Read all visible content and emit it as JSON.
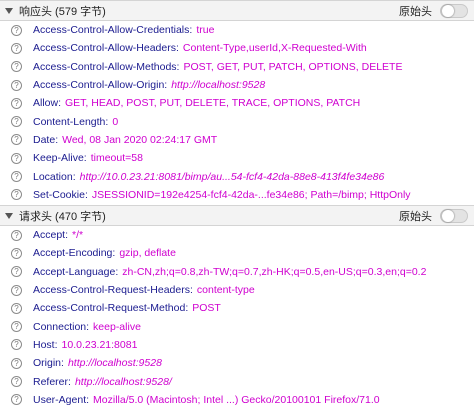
{
  "response_section": {
    "title": "响应头 (579 字节)",
    "raw_label": "原始头",
    "headers": [
      {
        "name": "Access-Control-Allow-Credentials",
        "value": "true"
      },
      {
        "name": "Access-Control-Allow-Headers",
        "value": "Content-Type,userId,X-Requested-With"
      },
      {
        "name": "Access-Control-Allow-Methods",
        "value": "POST, GET, PUT, PATCH, OPTIONS, DELETE"
      },
      {
        "name": "Access-Control-Allow-Origin",
        "value": "http://localhost:9528"
      },
      {
        "name": "Allow",
        "value": "GET, HEAD, POST, PUT, DELETE, TRACE, OPTIONS, PATCH"
      },
      {
        "name": "Content-Length",
        "value": "0"
      },
      {
        "name": "Date",
        "value": "Wed, 08 Jan 2020 02:24:17 GMT"
      },
      {
        "name": "Keep-Alive",
        "value": "timeout=58"
      },
      {
        "name": "Location",
        "value": "http://10.0.23.21:8081/bimp/au...54-fcf4-42da-88e8-413f4fe34e86"
      },
      {
        "name": "Set-Cookie",
        "value": "JSESSIONID=192e4254-fcf4-42da-...fe34e86; Path=/bimp; HttpOnly"
      }
    ]
  },
  "request_section": {
    "title": "请求头 (470 字节)",
    "raw_label": "原始头",
    "headers": [
      {
        "name": "Accept",
        "value": "*/*"
      },
      {
        "name": "Accept-Encoding",
        "value": "gzip, deflate"
      },
      {
        "name": "Accept-Language",
        "value": "zh-CN,zh;q=0.8,zh-TW;q=0.7,zh-HK;q=0.5,en-US;q=0.3,en;q=0.2"
      },
      {
        "name": "Access-Control-Request-Headers",
        "value": "content-type"
      },
      {
        "name": "Access-Control-Request-Method",
        "value": "POST"
      },
      {
        "name": "Connection",
        "value": "keep-alive"
      },
      {
        "name": "Host",
        "value": "10.0.23.21:8081"
      },
      {
        "name": "Origin",
        "value": "http://localhost:9528"
      },
      {
        "name": "Referer",
        "value": "http://localhost:9528/"
      },
      {
        "name": "User-Agent",
        "value": "Mozilla/5.0 (Macintosh; Intel ...) Gecko/20100101 Firefox/71.0"
      }
    ]
  },
  "icons": {
    "help": "?"
  },
  "colors": {
    "header_name": "#1b1b8f",
    "header_value": "#cf00cf",
    "section_bg": "#f3f3f3"
  }
}
